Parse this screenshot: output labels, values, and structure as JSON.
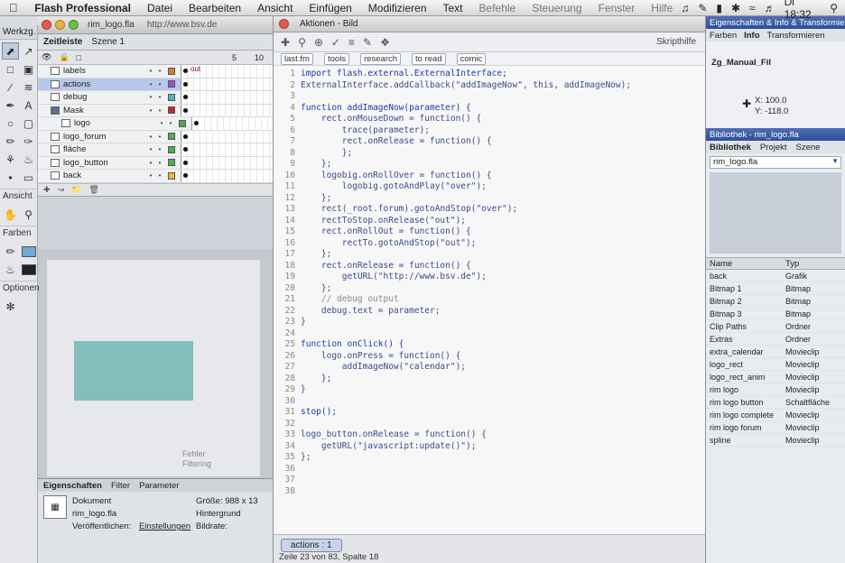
{
  "menubar": {
    "app_name": "Flash Professional",
    "items": [
      "Datei",
      "Bearbeiten",
      "Ansicht",
      "Einfügen",
      "Modifizieren",
      "Text",
      "Befehle",
      "Steuerung",
      "Fenster",
      "Hilfe"
    ],
    "clock": "Di 18:32"
  },
  "tools": {
    "title": "Werkzg.",
    "section_view": "Ansicht",
    "section_colors": "Farben",
    "section_options": "Optionen"
  },
  "document": {
    "tab": "rim_logo.fla",
    "url": "http://www.bsv.de",
    "timeline_tab": "Zeitleiste",
    "scene_tab": "Szene 1",
    "frame_numbers": [
      "5",
      "10"
    ],
    "layers": [
      {
        "name": "labels",
        "color": "#d47d2b",
        "label": "out"
      },
      {
        "name": "actions",
        "color": "#a94dd0",
        "label": ""
      },
      {
        "name": "debug",
        "color": "#4cb0c0",
        "label": ""
      },
      {
        "name": "Mask",
        "color": "#b63232",
        "label": ""
      },
      {
        "name": "logo",
        "color": "#4bb04b",
        "label": ""
      },
      {
        "name": "logo_forum",
        "color": "#4bb04b",
        "label": ""
      },
      {
        "name": "fläche",
        "color": "#4bb04b",
        "label": ""
      },
      {
        "name": "logo_button",
        "color": "#4bb04b",
        "label": ""
      },
      {
        "name": "back",
        "color": "#e0c022",
        "label": ""
      }
    ],
    "stage_caption_1": "Fehler",
    "stage_caption_2": "Filtering"
  },
  "properties": {
    "tabs": [
      "Eigenschaften",
      "Filter",
      "Parameter"
    ],
    "kind": "Dokument",
    "filename": "rim_logo.fla",
    "size_label": "Größe:",
    "size_value": "988 x 13",
    "publish_label": "Veröffentlichen:",
    "settings_label": "Einstellungen",
    "bg_label": "Hintergrund",
    "fps_label": "Bildrate:"
  },
  "actions": {
    "title": "Aktionen - Bild",
    "script_help": "Skripthilfe",
    "bookmarks": [
      "last.fm",
      "tools",
      "research",
      "to read",
      "comic"
    ],
    "code_lines": [
      {
        "n": "1",
        "t": "import flash.external.ExternalInterface;",
        "kind": "kw"
      },
      {
        "n": "2",
        "t": "ExternalInterface.addCallback(\"addImageNow\", this, addImageNow);",
        "kind": ""
      },
      {
        "n": "3",
        "t": "",
        "kind": ""
      },
      {
        "n": "4",
        "t": "function addImageNow(parameter) {",
        "kind": "kw"
      },
      {
        "n": "5",
        "t": "    rect.onMouseDown = function() {",
        "kind": ""
      },
      {
        "n": "6",
        "t": "        trace(parameter);",
        "kind": ""
      },
      {
        "n": "7",
        "t": "        rect.onRelease = function() {",
        "kind": ""
      },
      {
        "n": "8",
        "t": "        };",
        "kind": ""
      },
      {
        "n": "9",
        "t": "    };",
        "kind": ""
      },
      {
        "n": "10",
        "t": "    logobig.onRollOver = function() {",
        "kind": ""
      },
      {
        "n": "11",
        "t": "        logobig.gotoAndPlay(\"over\");",
        "kind": ""
      },
      {
        "n": "12",
        "t": "    };",
        "kind": ""
      },
      {
        "n": "13",
        "t": "    rect(_root.forum).gotoAndStop(\"over\");",
        "kind": ""
      },
      {
        "n": "14",
        "t": "    rectToStop.onRelease(\"out\");",
        "kind": ""
      },
      {
        "n": "15",
        "t": "    rect.onRollOut = function() {",
        "kind": ""
      },
      {
        "n": "16",
        "t": "        rectTo.gotoAndStop(\"out\");",
        "kind": ""
      },
      {
        "n": "17",
        "t": "    };",
        "kind": ""
      },
      {
        "n": "18",
        "t": "    rect.onRelease = function() {",
        "kind": ""
      },
      {
        "n": "19",
        "t": "        getURL(\"http://www.bsv.de\");",
        "kind": ""
      },
      {
        "n": "20",
        "t": "    };",
        "kind": ""
      },
      {
        "n": "21",
        "t": "    // debug output",
        "kind": "cm"
      },
      {
        "n": "22",
        "t": "    debug.text = parameter;",
        "kind": ""
      },
      {
        "n": "23",
        "t": "}",
        "kind": ""
      },
      {
        "n": "24",
        "t": "",
        "kind": ""
      },
      {
        "n": "25",
        "t": "function onClick() {",
        "kind": "kw"
      },
      {
        "n": "26",
        "t": "    logo.onPress = function() {",
        "kind": ""
      },
      {
        "n": "27",
        "t": "        addImageNow(\"calendar\");",
        "kind": ""
      },
      {
        "n": "28",
        "t": "    };",
        "kind": ""
      },
      {
        "n": "29",
        "t": "}",
        "kind": ""
      },
      {
        "n": "30",
        "t": "",
        "kind": ""
      },
      {
        "n": "31",
        "t": "stop();",
        "kind": "kw"
      },
      {
        "n": "32",
        "t": "",
        "kind": ""
      },
      {
        "n": "33",
        "t": "logo_button.onRelease = function() {",
        "kind": ""
      },
      {
        "n": "34",
        "t": "    getURL(\"javascript:update()\");",
        "kind": ""
      },
      {
        "n": "35",
        "t": "};",
        "kind": ""
      },
      {
        "n": "36",
        "t": "",
        "kind": ""
      },
      {
        "n": "37",
        "t": "",
        "kind": ""
      },
      {
        "n": "38",
        "t": "",
        "kind": ""
      }
    ],
    "action_tab": "actions : 1",
    "status": "Zeile 23 von 83, Spalte 18"
  },
  "right": {
    "info_header": "Eigenschaften & Info & Transformieren",
    "info_tabs": [
      "Farben",
      "Info",
      "Transformieren"
    ],
    "info_file": "Zg_Manual_Fil",
    "coord_x": "X: 100.0",
    "coord_y": "Y: -118.0",
    "library_header": "Bibliothek - rim_logo.fla",
    "library_tabs": [
      "Bibliothek",
      "Projekt",
      "Szene"
    ],
    "library_select": "rim_logo.fla",
    "col_name": "Name",
    "col_type": "Typ",
    "items": [
      {
        "name": "back",
        "type": "Grafik"
      },
      {
        "name": "Bitmap 1",
        "type": "Bitmap"
      },
      {
        "name": "Bitmap 2",
        "type": "Bitmap"
      },
      {
        "name": "Bitmap 3",
        "type": "Bitmap"
      },
      {
        "name": "Clip Paths",
        "type": "Ordner"
      },
      {
        "name": "Extras",
        "type": "Ordner"
      },
      {
        "name": "extra_calendar",
        "type": "Movieclip"
      },
      {
        "name": "logo_rect",
        "type": "Movieclip"
      },
      {
        "name": "logo_rect_anim",
        "type": "Movieclip"
      },
      {
        "name": "rim logo",
        "type": "Movieclip"
      },
      {
        "name": "rim logo button",
        "type": "Schaltfläche"
      },
      {
        "name": "rim logo complete",
        "type": "Movieclip"
      },
      {
        "name": "rim logo forum",
        "type": "Movieclip"
      },
      {
        "name": "spline",
        "type": "Movieclip"
      }
    ]
  }
}
